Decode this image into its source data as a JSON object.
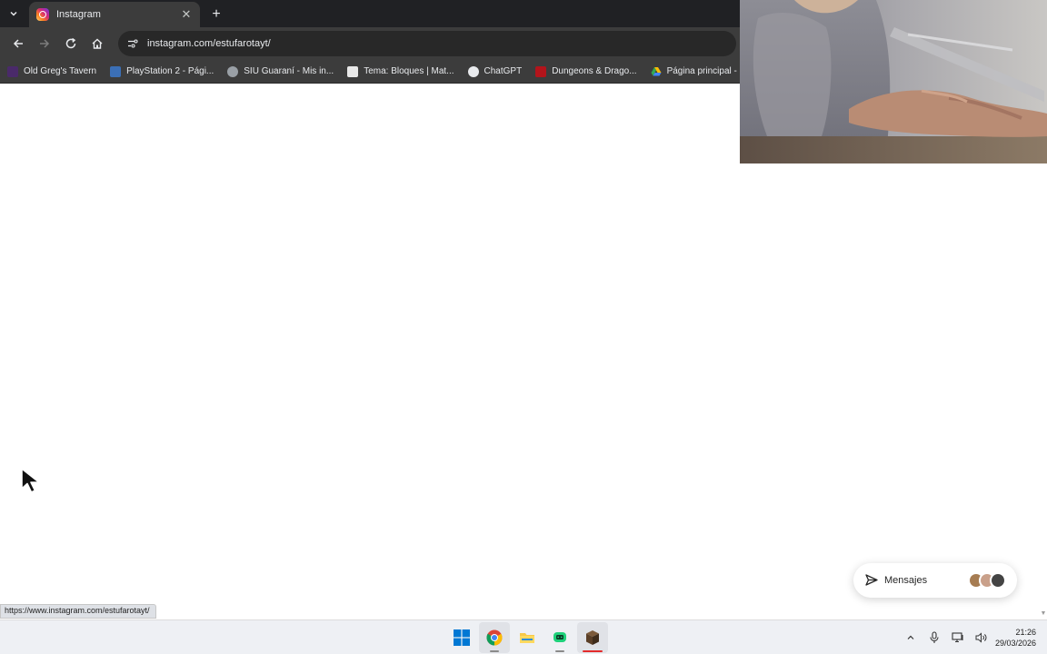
{
  "browser": {
    "tab": {
      "title": "Instagram",
      "close_glyph": "✕"
    },
    "new_tab_glyph": "+",
    "address_bar": {
      "url": "instagram.com/estufarotayt/"
    },
    "bookmarks": [
      {
        "label": "Old Greg's Tavern",
        "icon_color": "#4a2a6a"
      },
      {
        "label": "PlayStation 2 - Pági...",
        "icon_color": "#3b6fb6"
      },
      {
        "label": "SIU Guaraní - Mis in...",
        "icon_color": "#9aa0a6"
      },
      {
        "label": "Tema: Bloques | Mat...",
        "icon_color": "#e8e8e8"
      },
      {
        "label": "ChatGPT",
        "icon_color": "#e8eaed"
      },
      {
        "label": "Dungeons & Drago...",
        "icon_color": "#b3141b"
      },
      {
        "label": "Página principal - G...",
        "icon_color": "#fbbc04"
      }
    ]
  },
  "page": {
    "messages_label": "Mensajes",
    "avatar_colors": [
      "#a67c52",
      "#c9a08a",
      "#444444"
    ]
  },
  "status_bar": {
    "hover_url": "https://www.instagram.com/estufarotayt/"
  },
  "taskbar": {
    "apps": [
      "windows-start",
      "chrome",
      "file-explorer",
      "chat-app",
      "minecraft-launcher"
    ],
    "time": "21:26",
    "date": "29/03/2026"
  },
  "colors": {
    "chrome_dark": "#3c3c3c",
    "tabstrip": "#202124",
    "windows_blue": "#0078d4",
    "accent_red": "#e32b2b"
  }
}
